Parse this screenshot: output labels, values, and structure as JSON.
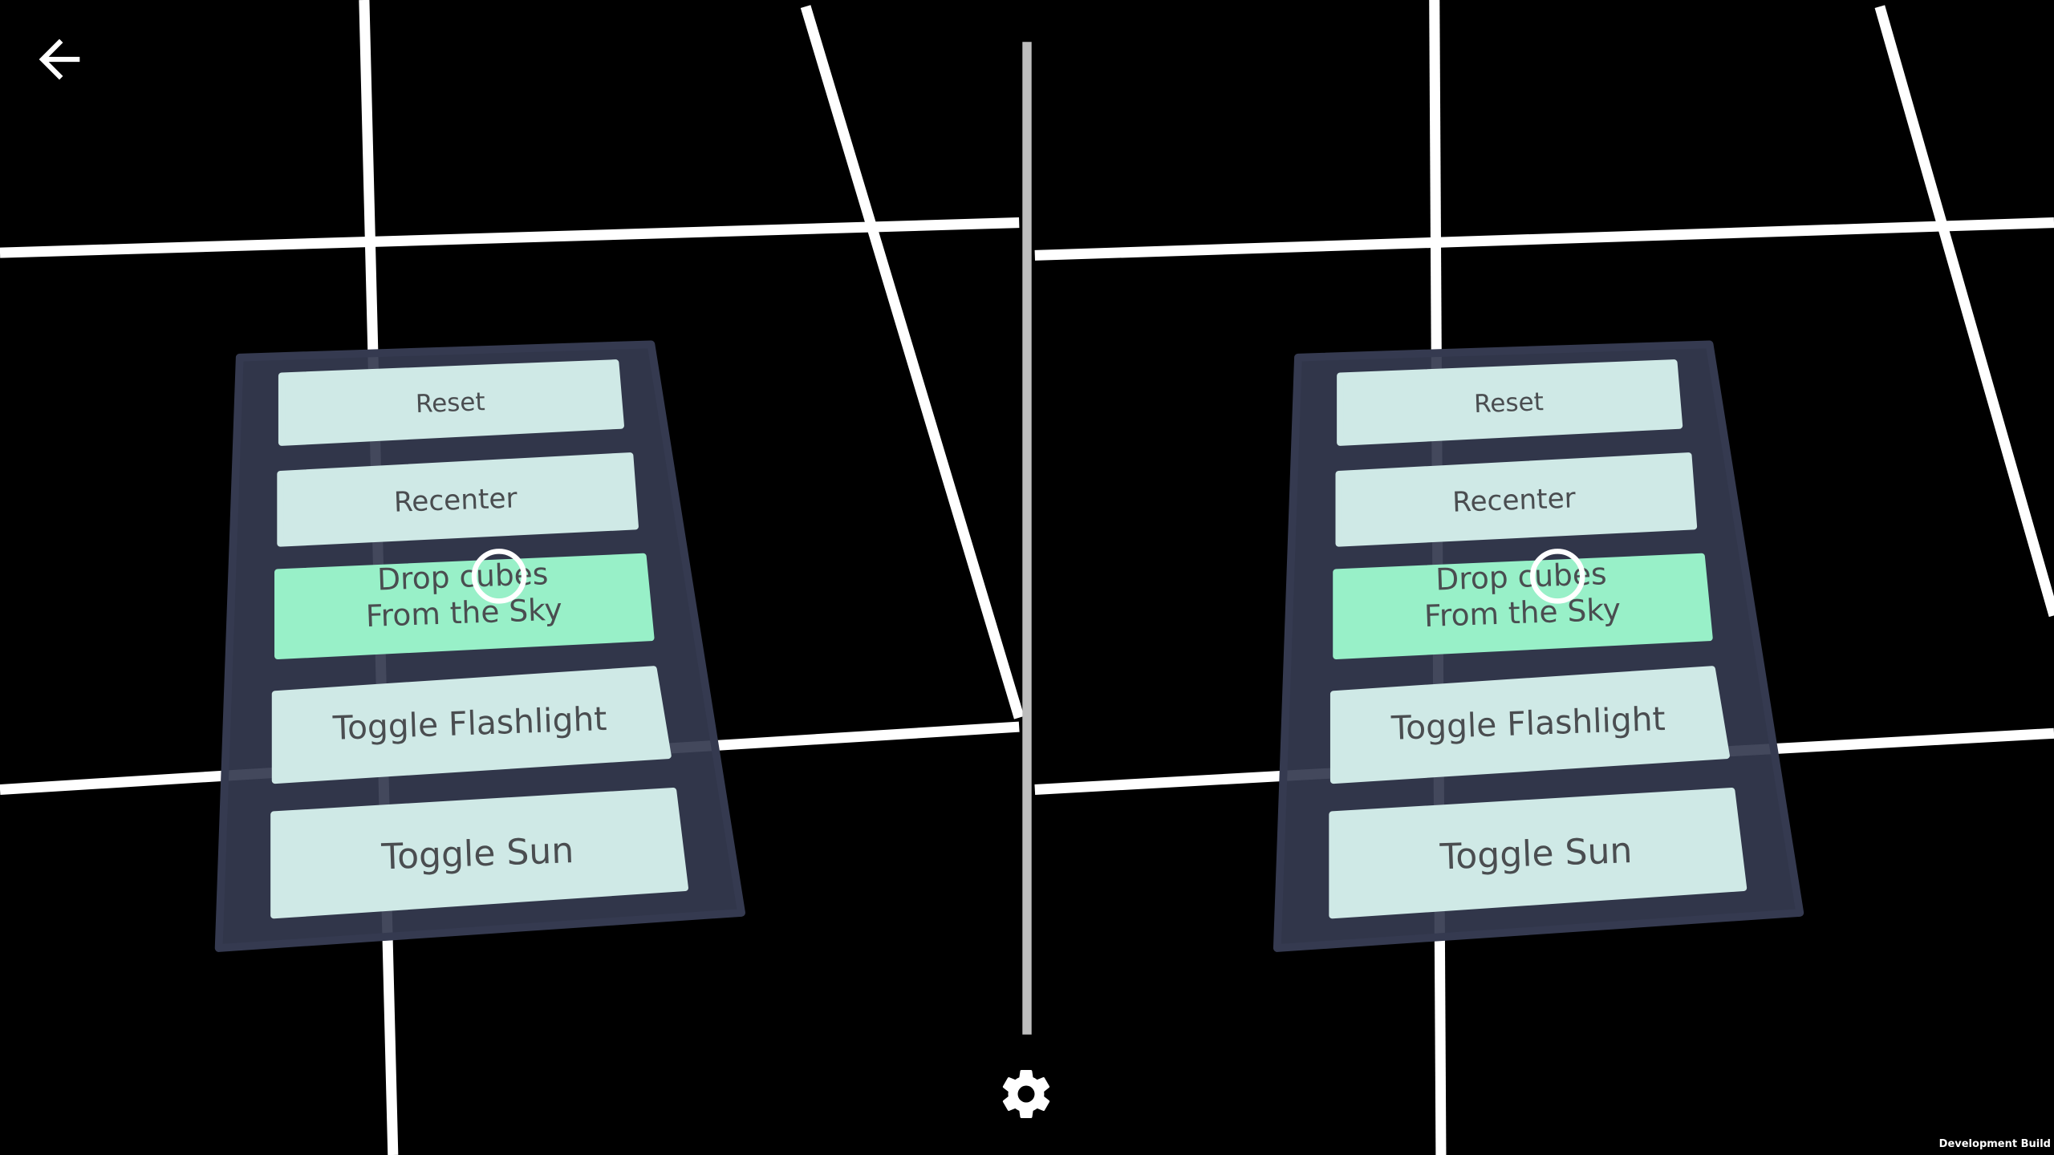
{
  "app": {
    "back_button": "arrow-left-icon",
    "settings_button": "gear-icon",
    "dev_badge": "Development Build"
  },
  "menu": {
    "buttons": [
      {
        "label": "Reset",
        "highlighted": false
      },
      {
        "label": "Recenter",
        "highlighted": false
      },
      {
        "label": "Drop cubes\nFrom the Sky",
        "highlighted": true
      },
      {
        "label": "Toggle Flashlight",
        "highlighted": false
      },
      {
        "label": "Toggle Sun",
        "highlighted": false
      }
    ]
  },
  "colors": {
    "background": "#000000",
    "grid": "#ffffff",
    "panel": "#353a50",
    "button": "#cfe9e6",
    "button_highlight": "#98f0c8",
    "text": "#4a4d50",
    "divider": "#bdbdbd"
  }
}
